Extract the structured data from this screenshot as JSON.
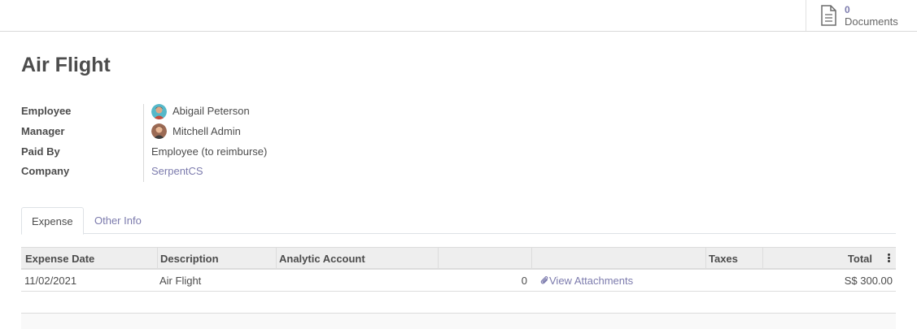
{
  "button_box": {
    "documents_count": "0",
    "documents_label": "Documents"
  },
  "record": {
    "title": "Air Flight"
  },
  "fields": {
    "employee_label": "Employee",
    "employee_value": "Abigail Peterson",
    "manager_label": "Manager",
    "manager_value": "Mitchell Admin",
    "paid_by_label": "Paid By",
    "paid_by_value": "Employee (to reimburse)",
    "company_label": "Company",
    "company_value": "SerpentCS"
  },
  "tabs": [
    {
      "label": "Expense",
      "active": true
    },
    {
      "label": "Other Info",
      "active": false
    }
  ],
  "table": {
    "headers": [
      "Expense Date",
      "Description",
      "Analytic Account",
      "",
      "",
      "Taxes",
      "Total"
    ],
    "rows": [
      {
        "expense_date": "11/02/2021",
        "description": "Air Flight",
        "analytic_account": "",
        "quantity": "0",
        "attachments": "View Attachments",
        "taxes": "",
        "total": "S$ 300.00"
      }
    ]
  },
  "colors": {
    "link": "#7c7bad",
    "text": "#4c4c4c"
  },
  "icons": {
    "documents": "document-icon",
    "attachment": "paperclip-icon",
    "column_options": "kebab-menu-icon"
  }
}
